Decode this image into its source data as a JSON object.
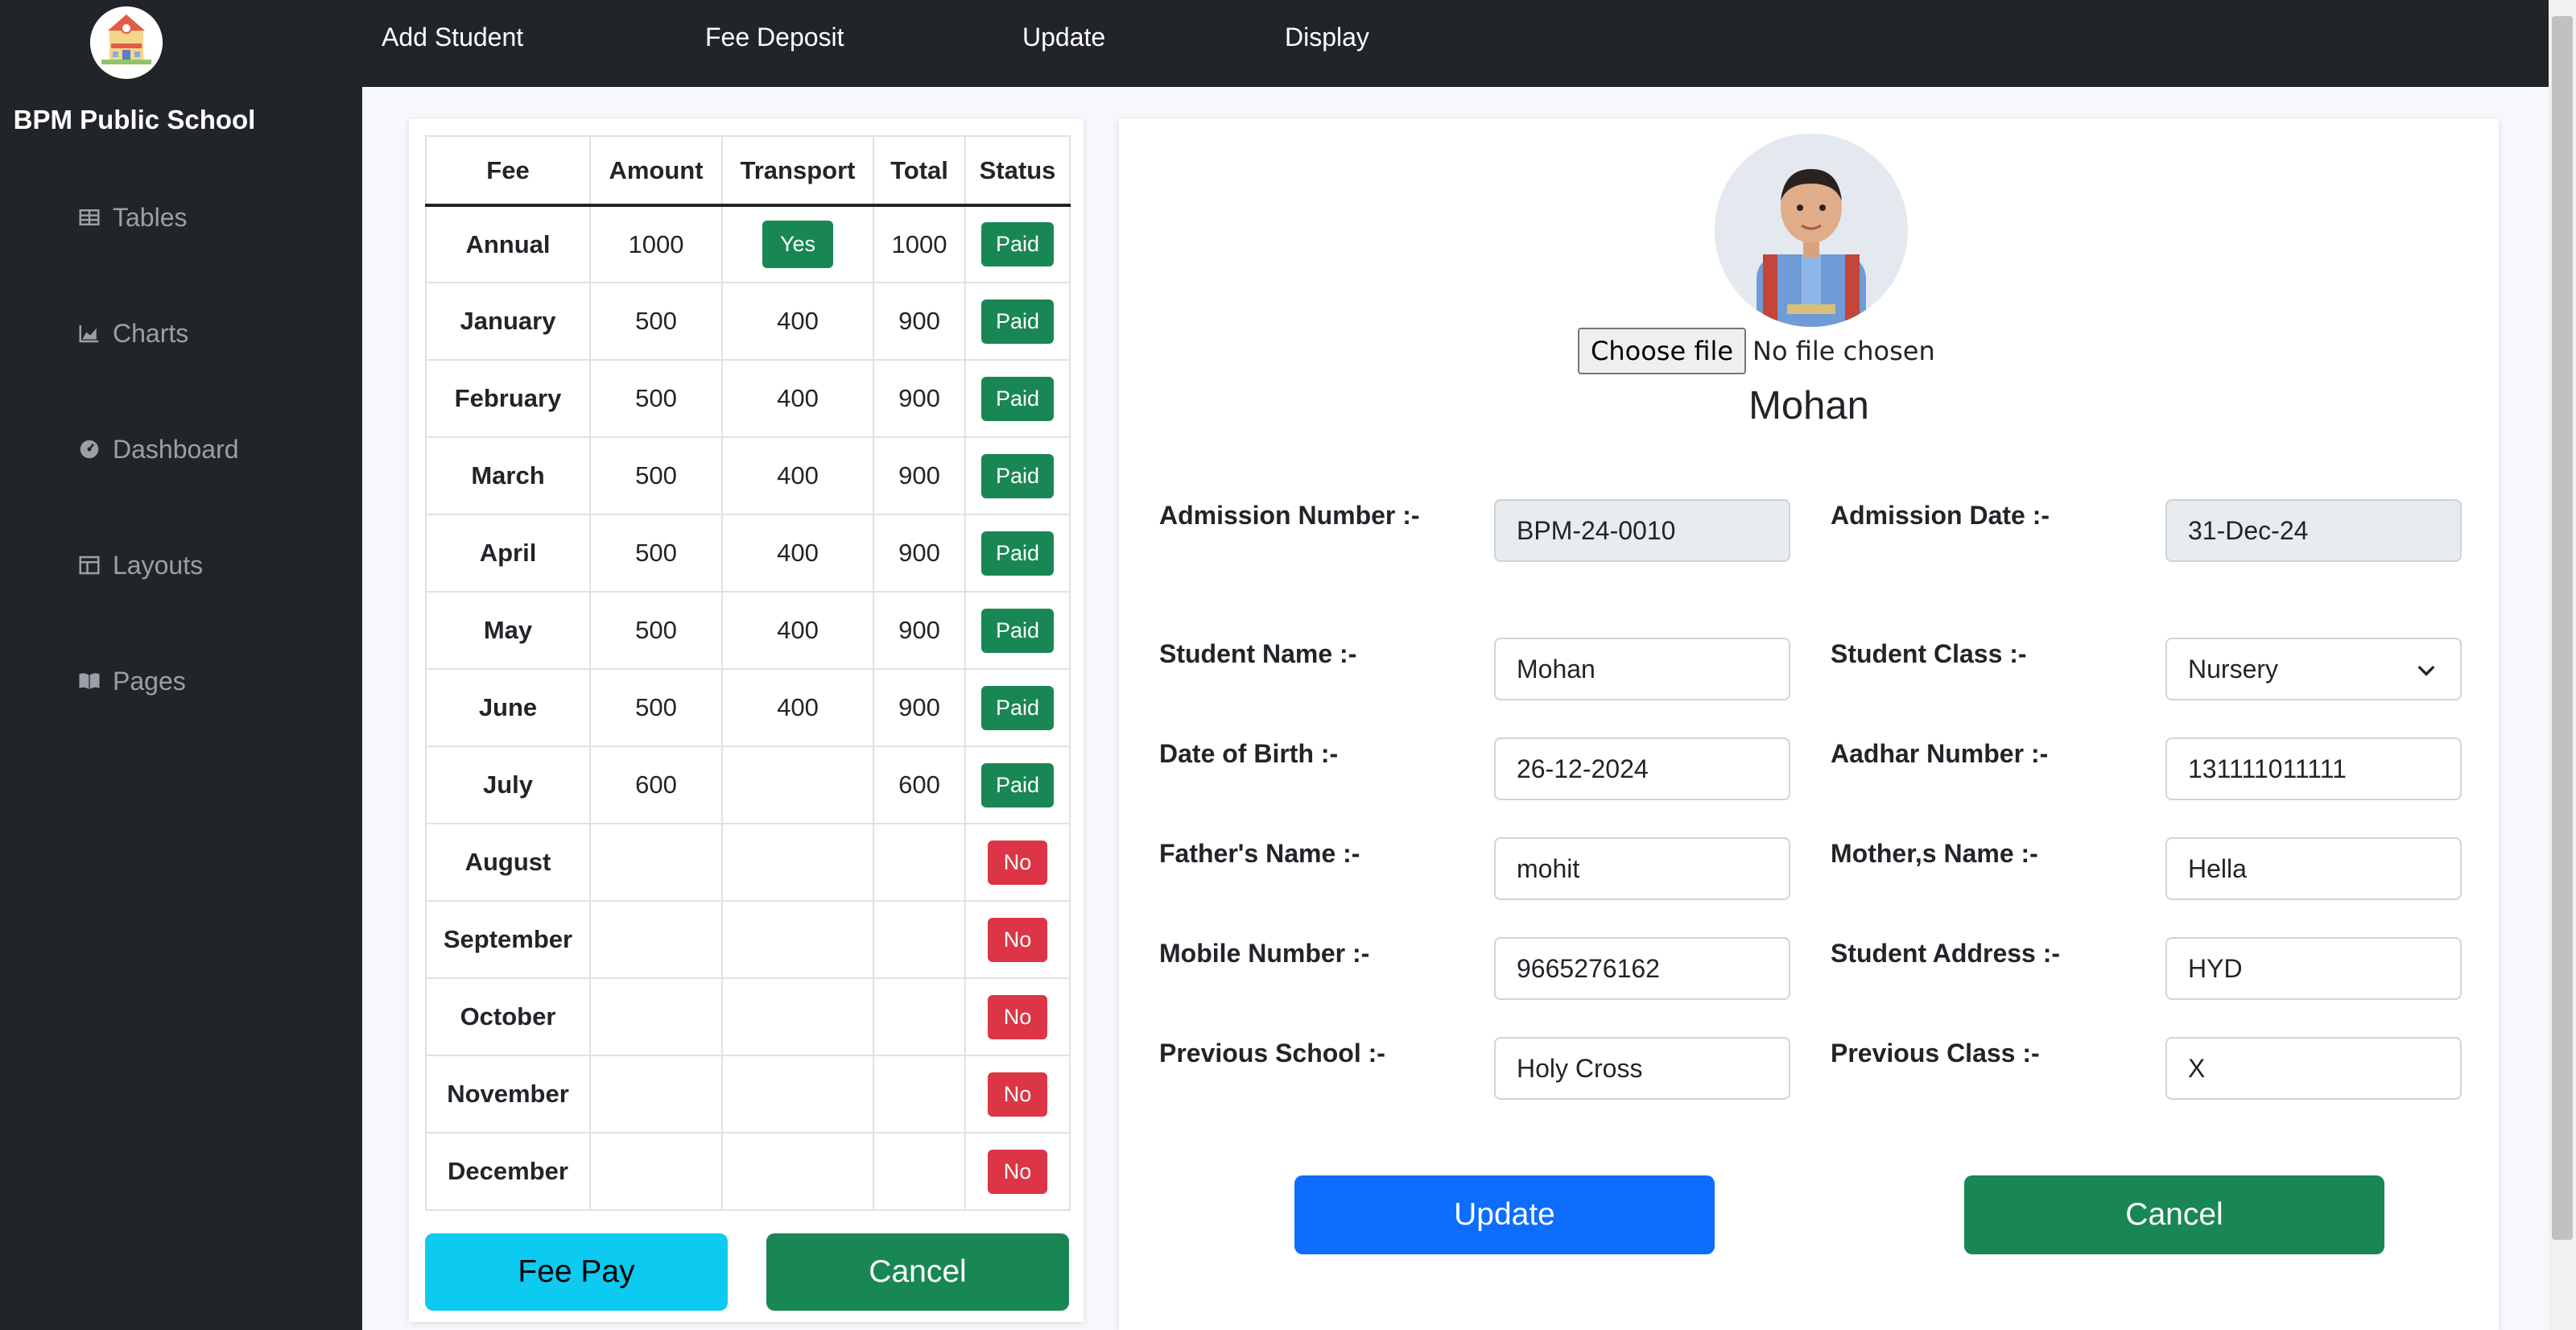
{
  "sidebar": {
    "brand": "BPM Public School",
    "items": [
      {
        "label": "Tables",
        "icon": "table-icon"
      },
      {
        "label": "Charts",
        "icon": "chart-icon"
      },
      {
        "label": "Dashboard",
        "icon": "dashboard-icon"
      },
      {
        "label": "Layouts",
        "icon": "layout-icon"
      },
      {
        "label": "Pages",
        "icon": "book-icon"
      }
    ]
  },
  "topnav": [
    "Add Student",
    "Fee Deposit",
    "Update",
    "Display"
  ],
  "fee_table": {
    "headers": [
      "Fee",
      "Amount",
      "Transport",
      "Total",
      "Status"
    ],
    "rows": [
      {
        "month": "Annual",
        "amount": "1000",
        "transport": "Yes",
        "total": "1000",
        "status": "Paid"
      },
      {
        "month": "January",
        "amount": "500",
        "transport": "400",
        "total": "900",
        "status": "Paid"
      },
      {
        "month": "February",
        "amount": "500",
        "transport": "400",
        "total": "900",
        "status": "Paid"
      },
      {
        "month": "March",
        "amount": "500",
        "transport": "400",
        "total": "900",
        "status": "Paid"
      },
      {
        "month": "April",
        "amount": "500",
        "transport": "400",
        "total": "900",
        "status": "Paid"
      },
      {
        "month": "May",
        "amount": "500",
        "transport": "400",
        "total": "900",
        "status": "Paid"
      },
      {
        "month": "June",
        "amount": "500",
        "transport": "400",
        "total": "900",
        "status": "Paid"
      },
      {
        "month": "July",
        "amount": "600",
        "transport": "",
        "total": "600",
        "status": "Paid"
      },
      {
        "month": "August",
        "amount": "",
        "transport": "",
        "total": "",
        "status": "No"
      },
      {
        "month": "September",
        "amount": "",
        "transport": "",
        "total": "",
        "status": "No"
      },
      {
        "month": "October",
        "amount": "",
        "transport": "",
        "total": "",
        "status": "No"
      },
      {
        "month": "November",
        "amount": "",
        "transport": "",
        "total": "",
        "status": "No"
      },
      {
        "month": "December",
        "amount": "",
        "transport": "",
        "total": "",
        "status": "No"
      }
    ],
    "fee_pay_label": "Fee Pay",
    "cancel_label": "Cancel"
  },
  "student": {
    "file_button": "Choose file",
    "file_status": "No file chosen",
    "name": "Mohan",
    "fields": {
      "admission_number": {
        "label": "Admission Number :-",
        "value": "BPM-24-0010"
      },
      "admission_date": {
        "label": "Admission Date :-",
        "value": "31-Dec-24"
      },
      "student_name": {
        "label": "Student Name :-",
        "value": "Mohan"
      },
      "student_class": {
        "label": "Student Class :-",
        "value": "Nursery"
      },
      "dob": {
        "label": "Date of Birth :-",
        "value": "26-12-2024"
      },
      "aadhar": {
        "label": "Aadhar Number :-",
        "value": "131111011111"
      },
      "father": {
        "label": "Father's Name :-",
        "value": "mohit"
      },
      "mother": {
        "label": "Mother,s Name :-",
        "value": "Hella"
      },
      "mobile": {
        "label": "Mobile Number :-",
        "value": "9665276162"
      },
      "address": {
        "label": "Student Address :-",
        "value": "HYD"
      },
      "prev_school": {
        "label": "Previous School :-",
        "value": "Holy Cross"
      },
      "prev_class": {
        "label": "Previous Class :-",
        "value": "X"
      }
    },
    "update_label": "Update",
    "cancel_label": "Cancel"
  },
  "colors": {
    "sidebar_bg": "#212529",
    "paid": "#198754",
    "unpaid": "#dc3545",
    "primary": "#0d6efd",
    "info": "#0dcaf0"
  }
}
